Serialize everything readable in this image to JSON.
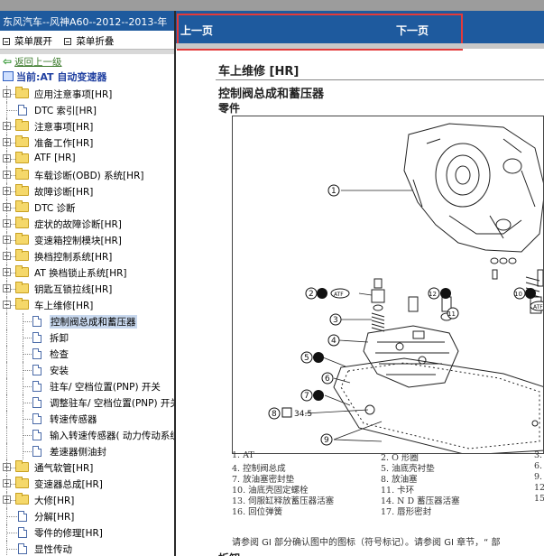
{
  "window": {
    "title": "东风汽车--风神A60--2012--2013-年"
  },
  "toolbar": {
    "expand_label": "菜单展开",
    "collapse_label": "菜单折叠"
  },
  "nav": {
    "back_label": "返回上一级",
    "current_label": "当前:AT 自动变速器"
  },
  "tree": [
    {
      "label": "应用注意事项[HR]",
      "type": "folder"
    },
    {
      "label": "DTC 索引[HR]",
      "type": "doc"
    },
    {
      "label": "注意事项[HR]",
      "type": "folder"
    },
    {
      "label": "准备工作[HR]",
      "type": "folder"
    },
    {
      "label": "ATF [HR]",
      "type": "folder"
    },
    {
      "label": "车载诊断(OBD) 系统[HR]",
      "type": "folder"
    },
    {
      "label": "故障诊断[HR]",
      "type": "folder"
    },
    {
      "label": "DTC 诊断",
      "type": "folder"
    },
    {
      "label": "症状的故障诊断[HR]",
      "type": "folder"
    },
    {
      "label": "变速箱控制模块[HR]",
      "type": "folder"
    },
    {
      "label": "换档控制系统[HR]",
      "type": "folder"
    },
    {
      "label": "AT 换档锁止系统[HR]",
      "type": "folder"
    },
    {
      "label": "钥匙互锁拉线[HR]",
      "type": "folder"
    },
    {
      "label": "车上维修[HR]",
      "type": "folder-open"
    },
    {
      "label": "控制阀总成和蓄压器",
      "type": "child-doc",
      "selected": true
    },
    {
      "label": "拆卸",
      "type": "child-doc"
    },
    {
      "label": "检查",
      "type": "child-doc"
    },
    {
      "label": "安装",
      "type": "child-doc"
    },
    {
      "label": "驻车/ 空档位置(PNP) 开关",
      "type": "child-doc"
    },
    {
      "label": "调整驻车/ 空档位置(PNP) 开关",
      "type": "child-doc"
    },
    {
      "label": "转速传感器",
      "type": "child-doc"
    },
    {
      "label": "输入转速传感器( 动力传动系统",
      "type": "child-doc"
    },
    {
      "label": "差速器侧油封",
      "type": "child-doc"
    },
    {
      "label": "通气软管[HR]",
      "type": "folder"
    },
    {
      "label": "变速器总成[HR]",
      "type": "folder"
    },
    {
      "label": "大修[HR]",
      "type": "folder"
    },
    {
      "label": "分解[HR]",
      "type": "doc"
    },
    {
      "label": "零件的修理[HR]",
      "type": "doc"
    },
    {
      "label": "显性传动",
      "type": "doc"
    }
  ],
  "content_nav": {
    "prev_label": "上一页",
    "next_label": "下一页"
  },
  "content": {
    "section_title": "车上维修 [HR]",
    "subtitle": "控制阀总成和蓄压器",
    "parts_heading": "零件",
    "torque_value": "34.5",
    "callouts": [
      "1",
      "2",
      "3",
      "4",
      "5",
      "6",
      "7",
      "8",
      "9",
      "10",
      "11",
      "12",
      "ATF",
      "ATF"
    ],
    "legend": [
      [
        "1.  AT",
        "2.  O 形圈",
        "3."
      ],
      [
        "4.  控制阀总成",
        "5.  油底壳衬垫",
        "6."
      ],
      [
        "7.  放油塞密封垫",
        "8.  放油塞",
        "9."
      ],
      [
        "10.  油底壳固定螺栓",
        "11.  卡环",
        "12"
      ],
      [
        "13.  伺服缸释放蓄压器活塞",
        "14.  N D 蓄压器活塞",
        "15"
      ],
      [
        "16.  回位弹簧",
        "17.  唇形密封",
        ""
      ]
    ],
    "note": "请参阅 GI 部分确认图中的图标（符号标记）。请参阅 GI 章节，“ 部",
    "disassembly_heading": "拆卸"
  },
  "colors": {
    "title_bar": "#1e5a9e",
    "highlight_box": "#e43a3a",
    "back_arrow": "#1a8a1a",
    "current_text": "#1f3fa0"
  }
}
